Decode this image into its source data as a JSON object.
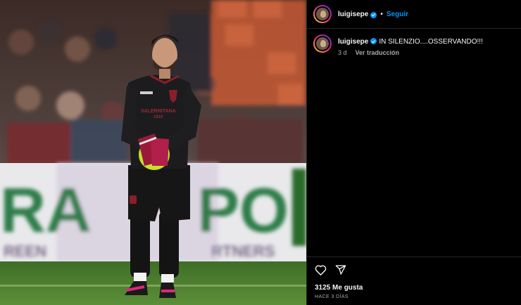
{
  "post": {
    "username": "luigisepe",
    "follow_label": "Seguir",
    "dot": "•",
    "caption_text": "IN SILENZIO....OSSERVANDO!!!",
    "time_ago": "3 d",
    "translate_label": "Ver traducción",
    "likes_text": "3125 Me gusta",
    "date_text": "HACE 3 DÍAS"
  },
  "photo": {
    "subject": "Goalkeeper in black kit holding ball, stadium background",
    "jersey_text": "SALERNITANA\n1919",
    "banner_letters": [
      "RA",
      "PO"
    ],
    "banner_sub": [
      "REEN",
      "RTNERS"
    ],
    "brand": "ZEUS"
  },
  "icons": {
    "heart": "heart-icon",
    "share": "share-icon",
    "verified": "verified-badge-icon"
  },
  "colors": {
    "background": "#000000",
    "accent": "#0095f6",
    "muted": "#a8a8a8",
    "divider": "#262626",
    "pitch": "#4a7d2f"
  }
}
